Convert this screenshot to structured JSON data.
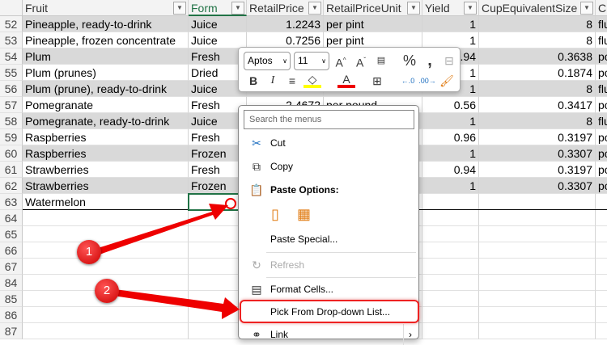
{
  "columns": [
    "Fruit",
    "Form",
    "RetailPrice",
    "RetailPriceUnit",
    "Yield",
    "CupEquivalentSize",
    "C"
  ],
  "rows": [
    {
      "n": "52",
      "fruit": "Pineapple, ready-to-drink",
      "form": "Juice",
      "price": "1.2243",
      "unit": "per pint",
      "yield": "1",
      "cup": "8",
      "c": "flu"
    },
    {
      "n": "53",
      "fruit": "Pineapple, frozen concentrate",
      "form": "Juice",
      "price": "0.7256",
      "unit": "per pint",
      "yield": "1",
      "cup": "8",
      "c": "flu"
    },
    {
      "n": "54",
      "fruit": "Plum",
      "form": "Fresh",
      "price": "",
      "unit": "",
      "yield": "0.94",
      "cup": "0.3638",
      "c": "po"
    },
    {
      "n": "55",
      "fruit": "Plum (prunes)",
      "form": "Dried",
      "price": "",
      "unit": "",
      "yield": "1",
      "cup": "0.1874",
      "c": "po"
    },
    {
      "n": "56",
      "fruit": "Plum (prune), ready-to-drink",
      "form": "Juice",
      "price": "",
      "unit": "",
      "yield": "1",
      "cup": "8",
      "c": "flu"
    },
    {
      "n": "57",
      "fruit": "Pomegranate",
      "form": "Fresh",
      "price": "2.4672",
      "unit": "per pound",
      "yield": "0.56",
      "cup": "0.3417",
      "c": "po"
    },
    {
      "n": "58",
      "fruit": "Pomegranate, ready-to-drink",
      "form": "Juice",
      "price": "",
      "unit": "",
      "yield": "1",
      "cup": "8",
      "c": "flu"
    },
    {
      "n": "59",
      "fruit": "Raspberries",
      "form": "Fresh",
      "price": "",
      "unit": "",
      "yield": "0.96",
      "cup": "0.3197",
      "c": "po"
    },
    {
      "n": "60",
      "fruit": "Raspberries",
      "form": "Frozen",
      "price": "",
      "unit": "",
      "yield": "1",
      "cup": "0.3307",
      "c": "po"
    },
    {
      "n": "61",
      "fruit": "Strawberries",
      "form": "Fresh",
      "price": "",
      "unit": "",
      "yield": "0.94",
      "cup": "0.3197",
      "c": "po"
    },
    {
      "n": "62",
      "fruit": "Strawberries",
      "form": "Frozen",
      "price": "",
      "unit": "",
      "yield": "1",
      "cup": "0.3307",
      "c": "po"
    },
    {
      "n": "63",
      "fruit": "Watermelon",
      "form": "",
      "price": "",
      "unit": "",
      "yield": "",
      "cup": "",
      "c": ""
    },
    {
      "n": "64"
    },
    {
      "n": "65"
    },
    {
      "n": "66"
    },
    {
      "n": "67"
    },
    {
      "n": "84"
    },
    {
      "n": "85"
    },
    {
      "n": "86"
    },
    {
      "n": "87"
    }
  ],
  "mini_toolbar": {
    "font": "Aptos",
    "size": "11"
  },
  "menu": {
    "search_placeholder": "Search the menus",
    "cut": "Cut",
    "copy": "Copy",
    "paste_options": "Paste Options:",
    "paste_special": "Paste Special...",
    "refresh": "Refresh",
    "format_cells": "Format Cells...",
    "pick_list": "Pick From Drop-down List...",
    "link": "Link"
  },
  "annotations": [
    "1",
    "2"
  ]
}
